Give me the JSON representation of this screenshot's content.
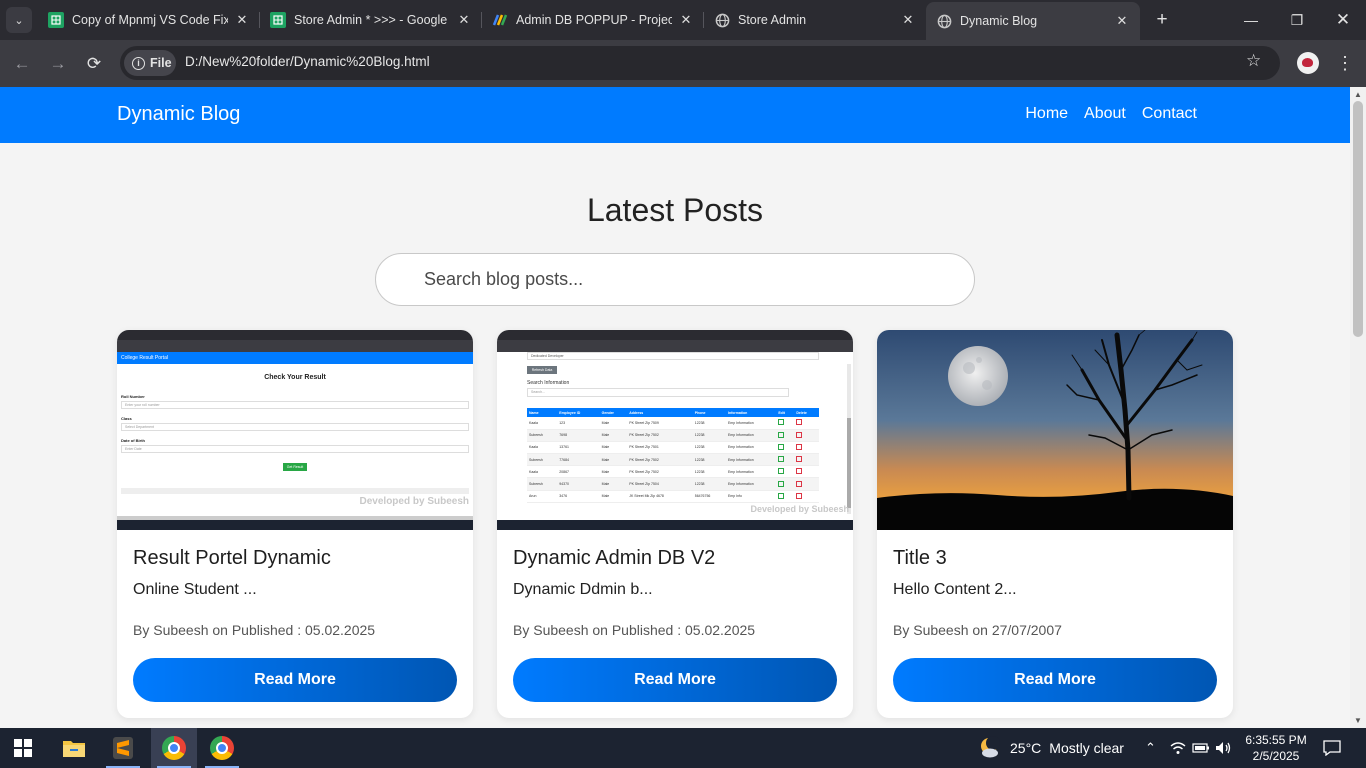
{
  "browser": {
    "tabs": [
      {
        "title": "Copy of Mpnmj VS Code Fix",
        "icon": "google-sheets-icon",
        "color": "#1ea362"
      },
      {
        "title": "Store Admin * >>> - Google",
        "icon": "google-sheets-icon",
        "color": "#1ea362"
      },
      {
        "title": "Admin DB POPPUP - Project",
        "icon": "apps-script-icon",
        "color": "#4285f4"
      },
      {
        "title": "Store Admin",
        "icon": "globe-icon",
        "color": "#c8c8c8"
      },
      {
        "title": "Dynamic Blog",
        "icon": "globe-icon",
        "color": "#c8c8c8",
        "active": true
      }
    ],
    "address": {
      "chip": "File",
      "url": "D:/New%20folder/Dynamic%20Blog.html"
    }
  },
  "site": {
    "brand": "Dynamic Blog",
    "nav": [
      "Home",
      "About",
      "Contact"
    ],
    "heading": "Latest Posts",
    "search_placeholder": "Search blog posts...",
    "brand_color": "#007bff"
  },
  "posts": [
    {
      "title": "Result Portel Dynamic",
      "excerpt": "Online Student ...",
      "meta": "By Subeesh on Published : 05.02.2025",
      "button": "Read More",
      "image": "screenshot-result-portal",
      "thumb": {
        "bar": "College Result Portal",
        "heading": "Check Your Result",
        "fields": [
          {
            "label": "Roll Number",
            "placeholder": "Enter your roll number"
          },
          {
            "label": "Class",
            "placeholder": "Select Department"
          },
          {
            "label": "Date of Birth",
            "placeholder": "Enter Date"
          }
        ],
        "button": "Get Result",
        "watermark": "Developed by Subeesh"
      }
    },
    {
      "title": "Dynamic Admin DB V2",
      "excerpt": "Dynamic Ddmin b...",
      "meta": "By Subeesh on Published : 05.02.2025",
      "button": "Read More",
      "image": "screenshot-admin-db",
      "thumb": {
        "select": "Dedicated Developer",
        "button": "Refresh Data",
        "search_label": "Search Information",
        "search_placeholder": "Search...",
        "columns": [
          "Name",
          "Employee ID",
          "Gender",
          "Address",
          "Phone",
          "Information",
          "Edit",
          "Delete"
        ],
        "rows": [
          [
            "Kaala",
            "123",
            "Male",
            "PK Street Zip 7509",
            "12238",
            "Emp Information"
          ],
          [
            "Subeesh",
            "7698",
            "Male",
            "PK Street Zip 7502",
            "12238",
            "Emp Information"
          ],
          [
            "Kaala",
            "13761",
            "Male",
            "PK Street Zip 7501",
            "12238",
            "Emp Information"
          ],
          [
            "Subeesh",
            "77684",
            "Male",
            "PK Street Zip 7502",
            "12238",
            "Emp Information"
          ],
          [
            "Kaala",
            "20867",
            "Male",
            "PK Street Zip 7502",
            "12238",
            "Emp Information"
          ],
          [
            "Subeesh",
            "94370",
            "Male",
            "PK Street Zip 7504",
            "12238",
            "Emp Information"
          ],
          [
            "Arun",
            "3476",
            "Male",
            "JK Street Mk Zip 4678",
            "56476756",
            "Emp Info"
          ]
        ],
        "watermark": "Developed by Subeesh"
      }
    },
    {
      "title": "Title 3",
      "excerpt": "Hello Content 2...",
      "meta": "By Subeesh on 27/07/2007",
      "button": "Read More",
      "image": "moon-tree-sunset-photo"
    }
  ],
  "taskbar": {
    "apps": [
      "windows-start-icon",
      "file-explorer-icon",
      "sublime-text-icon",
      "chrome-profile-icon",
      "chrome-icon"
    ],
    "weather": {
      "temp": "25°C",
      "desc": "Mostly clear"
    },
    "time": "6:35:55 PM",
    "date": "2/5/2025"
  }
}
